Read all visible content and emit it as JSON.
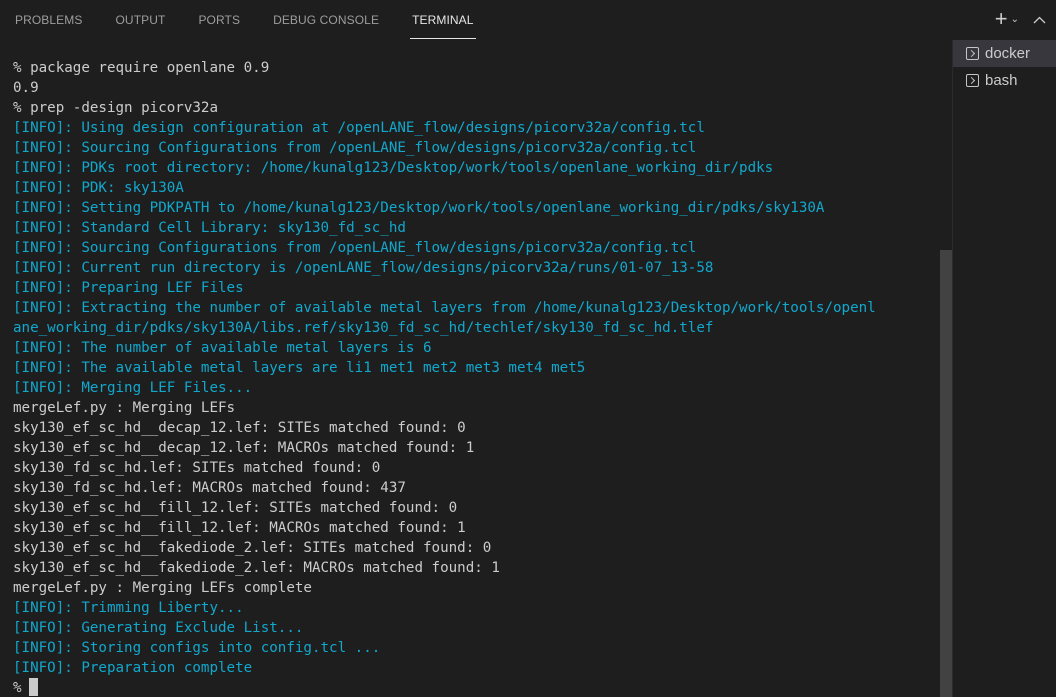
{
  "panel": {
    "tabs": [
      {
        "label": "PROBLEMS",
        "active": false
      },
      {
        "label": "OUTPUT",
        "active": false
      },
      {
        "label": "PORTS",
        "active": false
      },
      {
        "label": "DEBUG CONSOLE",
        "active": false
      },
      {
        "label": "TERMINAL",
        "active": true
      }
    ],
    "actions": {
      "new_terminal_icon": "plus-icon",
      "new_terminal_glyph": "+",
      "launch_profile_icon": "chevron-down-icon",
      "launch_profile_glyph": "⌄",
      "maximize_icon": "chevron-up-icon",
      "maximize_glyph": "^"
    }
  },
  "terminals": [
    {
      "name": "docker",
      "active": true,
      "icon": "terminal-icon"
    },
    {
      "name": "bash",
      "active": false,
      "icon": "terminal-icon"
    }
  ],
  "terminal_output": {
    "colors": {
      "info": "#11a8cd",
      "default": "#cccccc"
    },
    "lines": [
      {
        "type": "out",
        "text": "% package require openlane 0.9"
      },
      {
        "type": "out",
        "text": "0.9"
      },
      {
        "type": "out",
        "text": "% prep -design picorv32a"
      },
      {
        "type": "info",
        "text": "[INFO]: Using design configuration at /openLANE_flow/designs/picorv32a/config.tcl"
      },
      {
        "type": "info",
        "text": "[INFO]: Sourcing Configurations from /openLANE_flow/designs/picorv32a/config.tcl"
      },
      {
        "type": "info",
        "text": "[INFO]: PDKs root directory: /home/kunalg123/Desktop/work/tools/openlane_working_dir/pdks"
      },
      {
        "type": "info",
        "text": "[INFO]: PDK: sky130A"
      },
      {
        "type": "info",
        "text": "[INFO]: Setting PDKPATH to /home/kunalg123/Desktop/work/tools/openlane_working_dir/pdks/sky130A"
      },
      {
        "type": "info",
        "text": "[INFO]: Standard Cell Library: sky130_fd_sc_hd"
      },
      {
        "type": "info",
        "text": "[INFO]: Sourcing Configurations from /openLANE_flow/designs/picorv32a/config.tcl"
      },
      {
        "type": "info",
        "text": "[INFO]: Current run directory is /openLANE_flow/designs/picorv32a/runs/01-07_13-58"
      },
      {
        "type": "info",
        "text": "[INFO]: Preparing LEF Files"
      },
      {
        "type": "info",
        "text": "[INFO]: Extracting the number of available metal layers from /home/kunalg123/Desktop/work/tools/openl"
      },
      {
        "type": "info",
        "text": "ane_working_dir/pdks/sky130A/libs.ref/sky130_fd_sc_hd/techlef/sky130_fd_sc_hd.tlef"
      },
      {
        "type": "info",
        "text": "[INFO]: The number of available metal layers is 6"
      },
      {
        "type": "info",
        "text": "[INFO]: The available metal layers are li1 met1 met2 met3 met4 met5"
      },
      {
        "type": "info",
        "text": "[INFO]: Merging LEF Files..."
      },
      {
        "type": "out",
        "text": "mergeLef.py : Merging LEFs"
      },
      {
        "type": "out",
        "text": "sky130_ef_sc_hd__decap_12.lef: SITEs matched found: 0"
      },
      {
        "type": "out",
        "text": "sky130_ef_sc_hd__decap_12.lef: MACROs matched found: 1"
      },
      {
        "type": "out",
        "text": "sky130_fd_sc_hd.lef: SITEs matched found: 0"
      },
      {
        "type": "out",
        "text": "sky130_fd_sc_hd.lef: MACROs matched found: 437"
      },
      {
        "type": "out",
        "text": "sky130_ef_sc_hd__fill_12.lef: SITEs matched found: 0"
      },
      {
        "type": "out",
        "text": "sky130_ef_sc_hd__fill_12.lef: MACROs matched found: 1"
      },
      {
        "type": "out",
        "text": "sky130_ef_sc_hd__fakediode_2.lef: SITEs matched found: 0"
      },
      {
        "type": "out",
        "text": "sky130_ef_sc_hd__fakediode_2.lef: MACROs matched found: 1"
      },
      {
        "type": "out",
        "text": "mergeLef.py : Merging LEFs complete"
      },
      {
        "type": "info",
        "text": "[INFO]: Trimming Liberty..."
      },
      {
        "type": "info",
        "text": "[INFO]: Generating Exclude List..."
      },
      {
        "type": "info",
        "text": "[INFO]: Storing configs into config.tcl ..."
      },
      {
        "type": "info",
        "text": "[INFO]: Preparation complete"
      }
    ],
    "prompt": "%"
  },
  "scrollbar": {
    "thumb_start_fraction": 0.32,
    "thumb_size_fraction": 0.68
  }
}
